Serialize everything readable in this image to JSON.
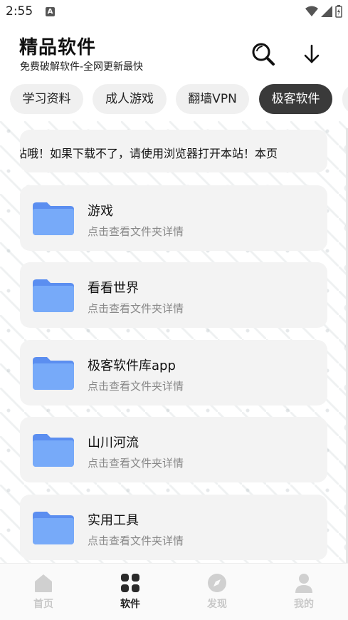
{
  "status_bar": {
    "time": "2:55",
    "notification_icon": "a-box-icon",
    "wifi_icon": "wifi-icon",
    "signal_icon": "signal-icon",
    "battery_icon": "battery-charging-icon"
  },
  "header": {
    "title": "精品软件",
    "subtitle": "免费破解软件-全网更新最快",
    "search_icon": "search-icon",
    "download_icon": "arrow-down-icon"
  },
  "tabs": [
    {
      "label": "学习资料",
      "active": false
    },
    {
      "label": "成人游戏",
      "active": false
    },
    {
      "label": "翻墙VPN",
      "active": false
    },
    {
      "label": "极客软件",
      "active": true
    }
  ],
  "notice": {
    "text": "站哦！如果下载不了，请使用浏览器打开本站！本页"
  },
  "folders": [
    {
      "name": "游戏",
      "subtitle": "点击查看文件夹详情"
    },
    {
      "name": "看看世界",
      "subtitle": "点击查看文件夹详情"
    },
    {
      "name": "极客软件库app",
      "subtitle": "点击查看文件夹详情"
    },
    {
      "name": "山川河流",
      "subtitle": "点击查看文件夹详情"
    },
    {
      "name": "实用工具",
      "subtitle": "点击查看文件夹详情"
    }
  ],
  "bottom_nav": [
    {
      "label": "首页",
      "icon": "home-icon",
      "active": false
    },
    {
      "label": "软件",
      "icon": "grid-icon",
      "active": true
    },
    {
      "label": "发现",
      "icon": "compass-icon",
      "active": false
    },
    {
      "label": "我的",
      "icon": "person-icon",
      "active": false
    }
  ],
  "colors": {
    "accent_dark": "#3a3a3a",
    "folder_blue": "#6ea3f7",
    "card_bg": "#f3f3f3",
    "nav_inactive": "#c8c8c8"
  }
}
